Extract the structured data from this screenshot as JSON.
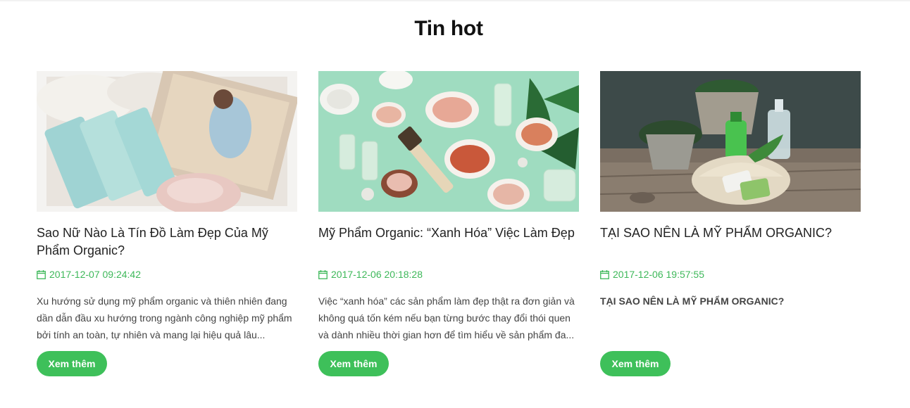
{
  "section": {
    "title": "Tin hot"
  },
  "posts": [
    {
      "title": "Sao Nữ Nào Là Tín Đồ Làm Đẹp Của Mỹ Phẩm Organic?",
      "date": "2017-12-07 09:24:42",
      "excerpt": "Xu hướng sử dụng mỹ phẩm organic và thiên nhiên đang dần dẫn đầu xu hướng trong ngành công nghiệp mỹ phẩm bởi tính an toàn, tự nhiên và mang lại hiệu quả lâu...",
      "button": "Xem thêm",
      "image_icon": "kora-organic-products-photo"
    },
    {
      "title": "Mỹ Phẩm Organic: “Xanh Hóa” Việc Làm Đẹp",
      "date": "2017-12-06 20:18:28",
      "excerpt": "Việc “xanh hóa” các sản phẩm làm đẹp thật ra đơn giản và không quá tốn kém nếu bạn từng bước thay đổi thói quen và dành nhiều thời gian hơn để tìm hiểu về sản phẩm đa...",
      "button": "Xem thêm",
      "image_icon": "organic-ingredients-flatlay-photo"
    },
    {
      "title": "TẠI SAO NÊN LÀ MỸ PHẨM ORGANIC?",
      "date": "2017-12-06 19:57:55",
      "excerpt": "TẠI SAO NÊN LÀ MỸ PHẨM ORGANIC?",
      "button": "Xem thêm",
      "image_icon": "plants-and-bottles-photo"
    }
  ],
  "colors": {
    "accent": "#3ec05a",
    "date": "#3eb85a",
    "text": "#222222",
    "excerpt": "#444444"
  },
  "icons": {
    "date": "calendar-icon"
  }
}
